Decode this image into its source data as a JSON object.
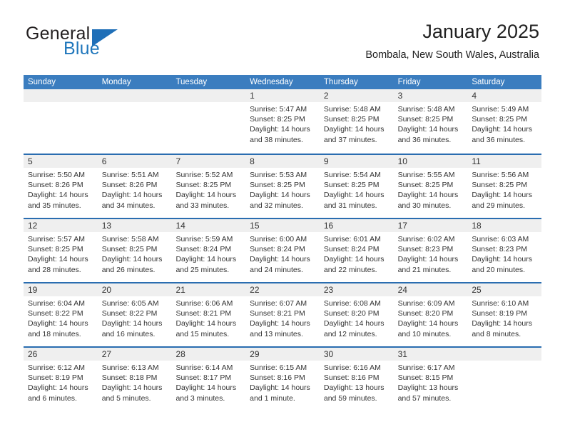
{
  "brand": {
    "word_one": "General",
    "word_two": "Blue",
    "triangle_color": "#1f6fb8",
    "blue_text_color": "#2077bc"
  },
  "header": {
    "title": "January 2025",
    "subtitle": "Bombala, New South Wales, Australia"
  },
  "theme": {
    "header_row_bg": "#3b7dbf",
    "week_divider": "#2a6db0",
    "day_band_bg": "#efefef"
  },
  "weekdays": [
    "Sunday",
    "Monday",
    "Tuesday",
    "Wednesday",
    "Thursday",
    "Friday",
    "Saturday"
  ],
  "weeks": [
    [
      {
        "day": "",
        "empty": true
      },
      {
        "day": "",
        "empty": true
      },
      {
        "day": "",
        "empty": true
      },
      {
        "day": "1",
        "sunrise": "Sunrise: 5:47 AM",
        "sunset": "Sunset: 8:25 PM",
        "daylight1": "Daylight: 14 hours",
        "daylight2": "and 38 minutes."
      },
      {
        "day": "2",
        "sunrise": "Sunrise: 5:48 AM",
        "sunset": "Sunset: 8:25 PM",
        "daylight1": "Daylight: 14 hours",
        "daylight2": "and 37 minutes."
      },
      {
        "day": "3",
        "sunrise": "Sunrise: 5:48 AM",
        "sunset": "Sunset: 8:25 PM",
        "daylight1": "Daylight: 14 hours",
        "daylight2": "and 36 minutes."
      },
      {
        "day": "4",
        "sunrise": "Sunrise: 5:49 AM",
        "sunset": "Sunset: 8:25 PM",
        "daylight1": "Daylight: 14 hours",
        "daylight2": "and 36 minutes."
      }
    ],
    [
      {
        "day": "5",
        "sunrise": "Sunrise: 5:50 AM",
        "sunset": "Sunset: 8:26 PM",
        "daylight1": "Daylight: 14 hours",
        "daylight2": "and 35 minutes."
      },
      {
        "day": "6",
        "sunrise": "Sunrise: 5:51 AM",
        "sunset": "Sunset: 8:26 PM",
        "daylight1": "Daylight: 14 hours",
        "daylight2": "and 34 minutes."
      },
      {
        "day": "7",
        "sunrise": "Sunrise: 5:52 AM",
        "sunset": "Sunset: 8:25 PM",
        "daylight1": "Daylight: 14 hours",
        "daylight2": "and 33 minutes."
      },
      {
        "day": "8",
        "sunrise": "Sunrise: 5:53 AM",
        "sunset": "Sunset: 8:25 PM",
        "daylight1": "Daylight: 14 hours",
        "daylight2": "and 32 minutes."
      },
      {
        "day": "9",
        "sunrise": "Sunrise: 5:54 AM",
        "sunset": "Sunset: 8:25 PM",
        "daylight1": "Daylight: 14 hours",
        "daylight2": "and 31 minutes."
      },
      {
        "day": "10",
        "sunrise": "Sunrise: 5:55 AM",
        "sunset": "Sunset: 8:25 PM",
        "daylight1": "Daylight: 14 hours",
        "daylight2": "and 30 minutes."
      },
      {
        "day": "11",
        "sunrise": "Sunrise: 5:56 AM",
        "sunset": "Sunset: 8:25 PM",
        "daylight1": "Daylight: 14 hours",
        "daylight2": "and 29 minutes."
      }
    ],
    [
      {
        "day": "12",
        "sunrise": "Sunrise: 5:57 AM",
        "sunset": "Sunset: 8:25 PM",
        "daylight1": "Daylight: 14 hours",
        "daylight2": "and 28 minutes."
      },
      {
        "day": "13",
        "sunrise": "Sunrise: 5:58 AM",
        "sunset": "Sunset: 8:25 PM",
        "daylight1": "Daylight: 14 hours",
        "daylight2": "and 26 minutes."
      },
      {
        "day": "14",
        "sunrise": "Sunrise: 5:59 AM",
        "sunset": "Sunset: 8:24 PM",
        "daylight1": "Daylight: 14 hours",
        "daylight2": "and 25 minutes."
      },
      {
        "day": "15",
        "sunrise": "Sunrise: 6:00 AM",
        "sunset": "Sunset: 8:24 PM",
        "daylight1": "Daylight: 14 hours",
        "daylight2": "and 24 minutes."
      },
      {
        "day": "16",
        "sunrise": "Sunrise: 6:01 AM",
        "sunset": "Sunset: 8:24 PM",
        "daylight1": "Daylight: 14 hours",
        "daylight2": "and 22 minutes."
      },
      {
        "day": "17",
        "sunrise": "Sunrise: 6:02 AM",
        "sunset": "Sunset: 8:23 PM",
        "daylight1": "Daylight: 14 hours",
        "daylight2": "and 21 minutes."
      },
      {
        "day": "18",
        "sunrise": "Sunrise: 6:03 AM",
        "sunset": "Sunset: 8:23 PM",
        "daylight1": "Daylight: 14 hours",
        "daylight2": "and 20 minutes."
      }
    ],
    [
      {
        "day": "19",
        "sunrise": "Sunrise: 6:04 AM",
        "sunset": "Sunset: 8:22 PM",
        "daylight1": "Daylight: 14 hours",
        "daylight2": "and 18 minutes."
      },
      {
        "day": "20",
        "sunrise": "Sunrise: 6:05 AM",
        "sunset": "Sunset: 8:22 PM",
        "daylight1": "Daylight: 14 hours",
        "daylight2": "and 16 minutes."
      },
      {
        "day": "21",
        "sunrise": "Sunrise: 6:06 AM",
        "sunset": "Sunset: 8:21 PM",
        "daylight1": "Daylight: 14 hours",
        "daylight2": "and 15 minutes."
      },
      {
        "day": "22",
        "sunrise": "Sunrise: 6:07 AM",
        "sunset": "Sunset: 8:21 PM",
        "daylight1": "Daylight: 14 hours",
        "daylight2": "and 13 minutes."
      },
      {
        "day": "23",
        "sunrise": "Sunrise: 6:08 AM",
        "sunset": "Sunset: 8:20 PM",
        "daylight1": "Daylight: 14 hours",
        "daylight2": "and 12 minutes."
      },
      {
        "day": "24",
        "sunrise": "Sunrise: 6:09 AM",
        "sunset": "Sunset: 8:20 PM",
        "daylight1": "Daylight: 14 hours",
        "daylight2": "and 10 minutes."
      },
      {
        "day": "25",
        "sunrise": "Sunrise: 6:10 AM",
        "sunset": "Sunset: 8:19 PM",
        "daylight1": "Daylight: 14 hours",
        "daylight2": "and 8 minutes."
      }
    ],
    [
      {
        "day": "26",
        "sunrise": "Sunrise: 6:12 AM",
        "sunset": "Sunset: 8:19 PM",
        "daylight1": "Daylight: 14 hours",
        "daylight2": "and 6 minutes."
      },
      {
        "day": "27",
        "sunrise": "Sunrise: 6:13 AM",
        "sunset": "Sunset: 8:18 PM",
        "daylight1": "Daylight: 14 hours",
        "daylight2": "and 5 minutes."
      },
      {
        "day": "28",
        "sunrise": "Sunrise: 6:14 AM",
        "sunset": "Sunset: 8:17 PM",
        "daylight1": "Daylight: 14 hours",
        "daylight2": "and 3 minutes."
      },
      {
        "day": "29",
        "sunrise": "Sunrise: 6:15 AM",
        "sunset": "Sunset: 8:16 PM",
        "daylight1": "Daylight: 14 hours",
        "daylight2": "and 1 minute."
      },
      {
        "day": "30",
        "sunrise": "Sunrise: 6:16 AM",
        "sunset": "Sunset: 8:16 PM",
        "daylight1": "Daylight: 13 hours",
        "daylight2": "and 59 minutes."
      },
      {
        "day": "31",
        "sunrise": "Sunrise: 6:17 AM",
        "sunset": "Sunset: 8:15 PM",
        "daylight1": "Daylight: 13 hours",
        "daylight2": "and 57 minutes."
      },
      {
        "day": "",
        "empty": true
      }
    ]
  ]
}
